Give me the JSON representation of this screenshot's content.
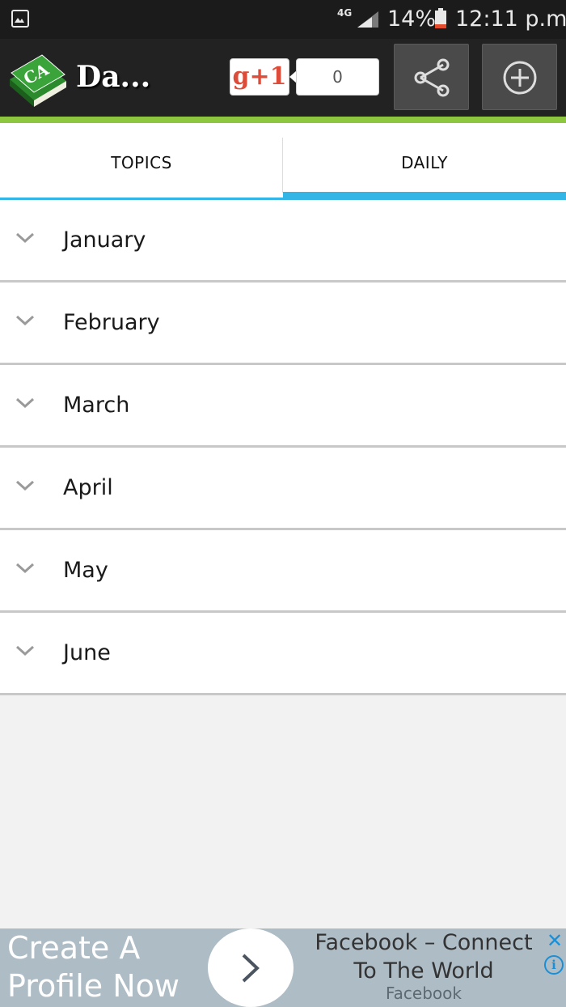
{
  "status_bar": {
    "network": "4G",
    "battery_percent": "14%",
    "time": "12:11 p.m."
  },
  "app_bar": {
    "logo_text": "CA",
    "title": "Da...",
    "gplus_label": "g+1",
    "plus_count": "0",
    "icons": {
      "share": "share-icon",
      "add": "add-circle-icon"
    }
  },
  "tabs": [
    {
      "label": "TOPICS",
      "selected": false
    },
    {
      "label": "DAILY",
      "selected": true
    }
  ],
  "months": [
    "January",
    "February",
    "March",
    "April",
    "May",
    "June"
  ],
  "ad": {
    "cta": "Create A Profile Now",
    "headline": "Facebook – Connect To The World",
    "source": "Facebook",
    "close": "✕",
    "info": "i"
  },
  "colors": {
    "accent_green": "#8dc63f",
    "tab_indicator": "#33b5e5",
    "app_bar": "#222222",
    "ad_background": "#aebcc6"
  }
}
